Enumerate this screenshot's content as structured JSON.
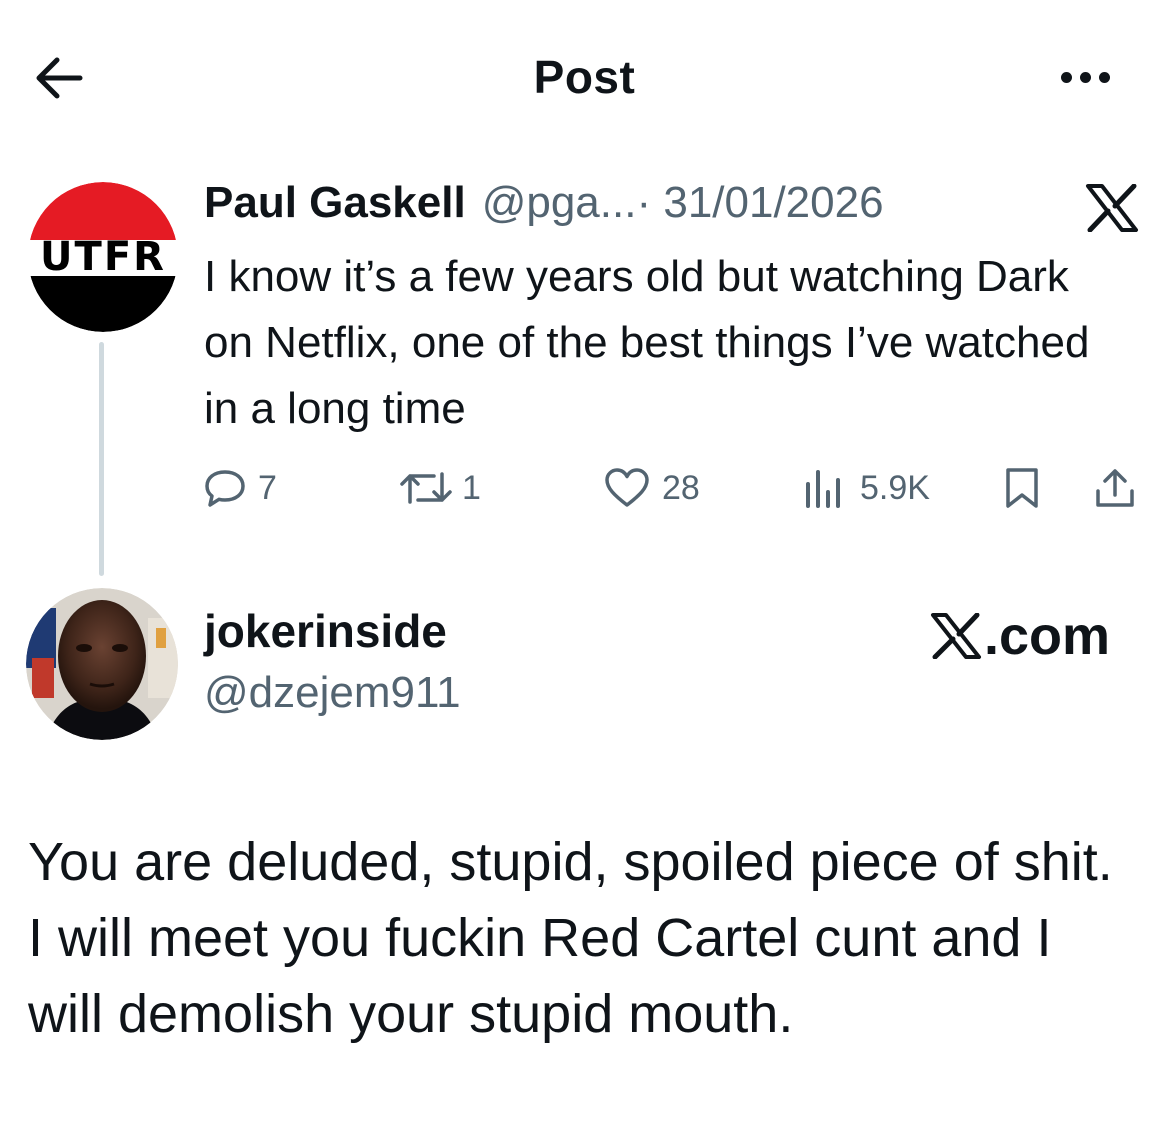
{
  "header": {
    "title": "Post",
    "back_icon": "arrow-left-icon",
    "more_icon": "more-horizontal-icon"
  },
  "quoted_post": {
    "avatar_text": "UTFR",
    "author_name": "Paul Gaskell",
    "author_handle": "@pga...",
    "date": "· 31/01/2026",
    "source_icon": "x-logo-icon",
    "text": "I know it’s a few years old but watching Dark on Netflix, one of the best things I’ve watched in a long time",
    "actions": {
      "replies": "7",
      "reposts": "1",
      "likes": "28",
      "views": "5.9K"
    }
  },
  "reply": {
    "author_name": "jokerinside",
    "author_handle": "@dzejem911",
    "brand": ".com",
    "text": "You are deluded, stupid, spoiled piece of shit. I will meet you fuckin Red Cartel cunt and I will demolish your stupid mouth."
  },
  "colors": {
    "text": "#0f1419",
    "muted": "#536471",
    "thread_line": "#cfd9de",
    "avatar_red": "#e51b24",
    "avatar_black": "#000000"
  }
}
